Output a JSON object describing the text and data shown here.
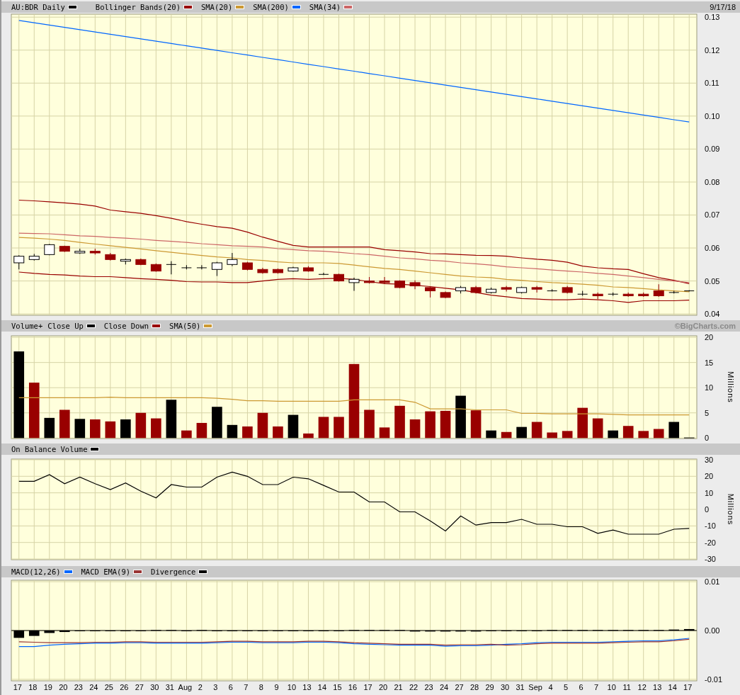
{
  "x_axis": {
    "labels": [
      "17",
      "18",
      "19",
      "20",
      "23",
      "24",
      "25",
      "26",
      "27",
      "30",
      "31",
      "Aug",
      "2",
      "3",
      "6",
      "7",
      "8",
      "9",
      "10",
      "13",
      "14",
      "15",
      "16",
      "17",
      "20",
      "21",
      "22",
      "23",
      "24",
      "27",
      "28",
      "29",
      "30",
      "31",
      "Sep",
      "4",
      "5",
      "6",
      "7",
      "10",
      "11",
      "12",
      "13",
      "14",
      "17"
    ]
  },
  "panels": [
    {
      "kind": "price",
      "right_text": "9/17/18",
      "chart_data": {
        "type": "candlestick",
        "title": "AU:BDR Daily",
        "grid": true,
        "ylim": [
          0.0396,
          0.1309
        ],
        "yticks": [
          {
            "value": 0.04,
            "label": "0.04"
          },
          {
            "value": 0.05,
            "label": "0.05"
          },
          {
            "value": 0.06,
            "label": "0.06"
          },
          {
            "value": 0.07,
            "label": "0.07"
          },
          {
            "value": 0.08,
            "label": "0.08"
          },
          {
            "value": 0.09,
            "label": "0.09"
          },
          {
            "value": 0.1,
            "label": "0.10"
          },
          {
            "value": 0.11,
            "label": "0.11"
          },
          {
            "value": 0.12,
            "label": "0.12"
          },
          {
            "value": 0.13,
            "label": "0.13"
          }
        ],
        "ohlc": [
          [
            0.0555,
            0.0578,
            0.0535,
            0.0575
          ],
          [
            0.0565,
            0.0582,
            0.0562,
            0.0575
          ],
          [
            0.058,
            0.0612,
            0.0578,
            0.061
          ],
          [
            0.0605,
            0.0607,
            0.0588,
            0.059
          ],
          [
            0.0585,
            0.0598,
            0.0582,
            0.059
          ],
          [
            0.059,
            0.0598,
            0.058,
            0.0585
          ],
          [
            0.058,
            0.0585,
            0.0562,
            0.0565
          ],
          [
            0.056,
            0.0568,
            0.055,
            0.0565
          ],
          [
            0.0565,
            0.0568,
            0.0548,
            0.055
          ],
          [
            0.055,
            0.0553,
            0.0528,
            0.053
          ],
          [
            0.055,
            0.056,
            0.052,
            0.055
          ],
          [
            0.054,
            0.0548,
            0.0535,
            0.054
          ],
          [
            0.054,
            0.0548,
            0.0535,
            0.054
          ],
          [
            0.0535,
            0.0558,
            0.0515,
            0.0555
          ],
          [
            0.055,
            0.0585,
            0.0545,
            0.0565
          ],
          [
            0.0555,
            0.0558,
            0.0532,
            0.0535
          ],
          [
            0.0535,
            0.054,
            0.0522,
            0.0525
          ],
          [
            0.0535,
            0.0538,
            0.0522,
            0.0525
          ],
          [
            0.053,
            0.0543,
            0.0528,
            0.054
          ],
          [
            0.054,
            0.0545,
            0.0528,
            0.053
          ],
          [
            0.052,
            0.0525,
            0.0518,
            0.052
          ],
          [
            0.052,
            0.0522,
            0.0498,
            0.05
          ],
          [
            0.0495,
            0.051,
            0.047,
            0.0505
          ],
          [
            0.05,
            0.0512,
            0.0492,
            0.0495
          ],
          [
            0.05,
            0.0512,
            0.0492,
            0.0495
          ],
          [
            0.05,
            0.0502,
            0.0478,
            0.048
          ],
          [
            0.0495,
            0.0502,
            0.0475,
            0.0485
          ],
          [
            0.048,
            0.0483,
            0.045,
            0.047
          ],
          [
            0.0465,
            0.0468,
            0.0448,
            0.045
          ],
          [
            0.047,
            0.0485,
            0.0462,
            0.048
          ],
          [
            0.048,
            0.0485,
            0.0462,
            0.0465
          ],
          [
            0.0465,
            0.048,
            0.0462,
            0.0475
          ],
          [
            0.048,
            0.0485,
            0.0468,
            0.0475
          ],
          [
            0.0465,
            0.0483,
            0.0462,
            0.048
          ],
          [
            0.048,
            0.0485,
            0.0465,
            0.0475
          ],
          [
            0.047,
            0.0475,
            0.0468,
            0.047
          ],
          [
            0.048,
            0.0485,
            0.0462,
            0.0465
          ],
          [
            0.046,
            0.047,
            0.0455,
            0.046
          ],
          [
            0.046,
            0.0465,
            0.0445,
            0.0455
          ],
          [
            0.046,
            0.0465,
            0.0455,
            0.046
          ],
          [
            0.046,
            0.0465,
            0.0452,
            0.0455
          ],
          [
            0.046,
            0.0465,
            0.0452,
            0.0455
          ],
          [
            0.047,
            0.049,
            0.0452,
            0.0455
          ],
          [
            0.0465,
            0.047,
            0.0462,
            0.0465
          ],
          [
            0.047,
            0.0472,
            0.0468,
            0.047
          ]
        ],
        "series": [
          {
            "name": "Bollinger Bands(20)",
            "type": "line",
            "color": "#990000",
            "values": [
              0.0745,
              0.0743,
              0.074,
              0.0737,
              0.0733,
              0.0727,
              0.0715,
              0.071,
              0.0705,
              0.0698,
              0.069,
              0.068,
              0.0672,
              0.0665,
              0.066,
              0.0648,
              0.0633,
              0.062,
              0.0608,
              0.0603,
              0.0603,
              0.0603,
              0.0603,
              0.0603,
              0.0595,
              0.0592,
              0.0588,
              0.0583,
              0.0582,
              0.058,
              0.0578,
              0.0577,
              0.0575,
              0.057,
              0.0566,
              0.0563,
              0.0557,
              0.0545,
              0.054,
              0.0537,
              0.0535,
              0.0522,
              0.051,
              0.0502,
              0.0492
            ]
          },
          {
            "type": "line",
            "color": "#990000",
            "values": [
              0.0527,
              0.0523,
              0.052,
              0.0518,
              0.0515,
              0.0513,
              0.0513,
              0.051,
              0.0507,
              0.0505,
              0.0502,
              0.0498,
              0.0497,
              0.0497,
              0.0495,
              0.0495,
              0.05,
              0.0505,
              0.0507,
              0.0505,
              0.0507,
              0.0508,
              0.0505,
              0.0498,
              0.0492,
              0.049,
              0.0487,
              0.0483,
              0.0478,
              0.0473,
              0.0465,
              0.0457,
              0.0452,
              0.0447,
              0.0445,
              0.0443,
              0.0443,
              0.0445,
              0.0443,
              0.044,
              0.0435,
              0.044,
              0.044,
              0.044,
              0.0442
            ]
          },
          {
            "name": "SMA(20)",
            "type": "line",
            "color": "#cc9933",
            "values": [
              0.0632,
              0.063,
              0.0627,
              0.0623,
              0.0617,
              0.0612,
              0.0607,
              0.0602,
              0.0597,
              0.0592,
              0.0587,
              0.0582,
              0.0577,
              0.0573,
              0.057,
              0.0565,
              0.0562,
              0.0558,
              0.0555,
              0.0555,
              0.0555,
              0.0553,
              0.0548,
              0.0543,
              0.0538,
              0.0535,
              0.053,
              0.0525,
              0.052,
              0.0515,
              0.0512,
              0.051,
              0.0505,
              0.0502,
              0.0498,
              0.0495,
              0.0493,
              0.049,
              0.0487,
              0.0482,
              0.048,
              0.0477,
              0.0473,
              0.047,
              0.0467
            ]
          },
          {
            "name": "SMA(200)",
            "type": "line",
            "color": "#0066ff",
            "values": [
              0.129,
              0.1283,
              0.1276,
              0.1269,
              0.1262,
              0.1255,
              0.1248,
              0.1241,
              0.1234,
              0.1227,
              0.122,
              0.1213,
              0.1206,
              0.1199,
              0.1192,
              0.1185,
              0.1178,
              0.1171,
              0.1164,
              0.1157,
              0.115,
              0.1143,
              0.1136,
              0.1129,
              0.1122,
              0.1115,
              0.1108,
              0.1101,
              0.1094,
              0.1087,
              0.108,
              0.1073,
              0.1066,
              0.1059,
              0.1052,
              0.1045,
              0.1038,
              0.1031,
              0.1024,
              0.1017,
              0.101,
              0.1003,
              0.0996,
              0.0989,
              0.0982
            ]
          },
          {
            "name": "SMA(34)",
            "type": "line",
            "color": "#cc6666",
            "values": [
              0.0645,
              0.0644,
              0.0643,
              0.064,
              0.0637,
              0.0635,
              0.0632,
              0.063,
              0.0627,
              0.0623,
              0.062,
              0.0617,
              0.0613,
              0.061,
              0.0607,
              0.0605,
              0.0603,
              0.0598,
              0.0595,
              0.0592,
              0.059,
              0.0587,
              0.0583,
              0.058,
              0.0575,
              0.057,
              0.0567,
              0.0563,
              0.056,
              0.0555,
              0.0552,
              0.0548,
              0.0543,
              0.054,
              0.0537,
              0.0533,
              0.053,
              0.0527,
              0.0523,
              0.052,
              0.0515,
              0.051,
              0.0505,
              0.05,
              0.0495
            ]
          }
        ]
      }
    },
    {
      "kind": "volume",
      "right_text": "©BigCharts.com",
      "chart_data": {
        "type": "bar",
        "title": "Volume+",
        "grid": true,
        "ylabel": "Millions",
        "ylim": [
          -0.1,
          20.3
        ],
        "yticks": [
          {
            "value": 0,
            "label": "0"
          },
          {
            "value": 5,
            "label": "5"
          },
          {
            "value": 10,
            "label": "10"
          },
          {
            "value": 15,
            "label": "15"
          },
          {
            "value": 20,
            "label": "20"
          }
        ],
        "series": [
          {
            "name": "Close Up",
            "color": "#000000",
            "values": [
              17.2,
              null,
              4,
              null,
              3.8,
              null,
              null,
              3.7,
              null,
              null,
              7.6,
              null,
              null,
              6.2,
              2.6,
              null,
              null,
              null,
              4.6,
              null,
              null,
              null,
              null,
              null,
              null,
              null,
              null,
              null,
              null,
              8.4,
              null,
              1.5,
              null,
              2.2,
              null,
              null,
              null,
              null,
              null,
              1.5,
              null,
              null,
              null,
              3.2,
              0.1
            ]
          },
          {
            "name": "Close Down",
            "color": "#990000",
            "values": [
              null,
              11,
              null,
              5.6,
              null,
              3.7,
              3.3,
              null,
              5,
              3.9,
              null,
              1.5,
              3,
              null,
              null,
              2.3,
              5,
              2.3,
              null,
              0.9,
              4.2,
              4.2,
              14.7,
              5.6,
              2.1,
              6.4,
              3.7,
              5.3,
              5.4,
              null,
              5.5,
              null,
              1.2,
              null,
              3.2,
              1.1,
              1.4,
              6,
              3.9,
              null,
              2.4,
              1.4,
              1.8,
              null,
              null
            ]
          },
          {
            "name": "SMA(50)",
            "type": "line",
            "color": "#cc9933",
            "values": [
              8,
              8,
              8,
              8,
              8,
              8,
              8.1,
              8,
              8,
              8,
              8,
              8,
              8,
              7.9,
              7.7,
              7.4,
              7.4,
              7.3,
              7.3,
              7.3,
              7.3,
              7.3,
              7.6,
              7.6,
              7.6,
              7.6,
              7.1,
              5.8,
              5.8,
              5.8,
              5.6,
              5.6,
              5.6,
              4.9,
              4.9,
              4.8,
              4.8,
              4.8,
              4.8,
              4.7,
              4.6,
              4.6,
              4.6,
              4.6,
              4.6
            ]
          }
        ]
      }
    },
    {
      "kind": "obv",
      "chart_data": {
        "type": "line",
        "grid": true,
        "ylabel": "Millions",
        "ylim": [
          -30.4,
          30.4
        ],
        "yticks": [
          {
            "value": -30,
            "label": "-30"
          },
          {
            "value": -20,
            "label": "-20"
          },
          {
            "value": -10,
            "label": "-10"
          },
          {
            "value": 0,
            "label": "0"
          },
          {
            "value": 10,
            "label": "10"
          },
          {
            "value": 20,
            "label": "20"
          },
          {
            "value": 30,
            "label": "30"
          }
        ],
        "series": [
          {
            "name": "On Balance Volume",
            "color": "#000000",
            "values": [
              17,
              17,
              21,
              15.5,
              19.5,
              15.5,
              12,
              16,
              11,
              7,
              15,
              13.5,
              13.5,
              19.5,
              22.5,
              20,
              15,
              15,
              19.5,
              18.5,
              14.5,
              10.5,
              10.5,
              4.5,
              4.5,
              -1.5,
              -1.5,
              -7,
              -13,
              -4,
              -9.5,
              -8,
              -8,
              -6,
              -9,
              -9,
              -10.5,
              -10.5,
              -14.5,
              -12.5,
              -15,
              -15,
              -15,
              -12,
              -11.5
            ]
          }
        ]
      }
    },
    {
      "kind": "macd",
      "chart_data": {
        "type": "line",
        "grid": true,
        "ylim": [
          -0.0103,
          0.0103
        ],
        "yticks": [
          {
            "value": -0.01,
            "label": "-0.01"
          },
          {
            "value": 0,
            "label": "0.00"
          },
          {
            "value": 0.01,
            "label": "0.01"
          }
        ],
        "series": [
          {
            "name": "MACD(12,26)",
            "color": "#0066ff",
            "values": [
              -0.0033,
              -0.0033,
              -0.003,
              -0.0028,
              -0.0027,
              -0.0026,
              -0.0026,
              -0.0025,
              -0.0025,
              -0.0026,
              -0.0026,
              -0.0026,
              -0.0026,
              -0.0025,
              -0.0024,
              -0.0024,
              -0.0025,
              -0.0025,
              -0.0025,
              -0.0024,
              -0.0024,
              -0.0025,
              -0.0027,
              -0.0028,
              -0.0029,
              -0.003,
              -0.003,
              -0.003,
              -0.0032,
              -0.0031,
              -0.0031,
              -0.003,
              -0.0028,
              -0.0027,
              -0.0025,
              -0.0024,
              -0.0024,
              -0.0024,
              -0.0024,
              -0.0023,
              -0.0022,
              -0.0021,
              -0.0021,
              -0.0019,
              -0.0016
            ]
          },
          {
            "name": "MACD EMA(9)",
            "color": "#993333",
            "values": [
              -0.0023,
              -0.0024,
              -0.0025,
              -0.0025,
              -0.0025,
              -0.0024,
              -0.0024,
              -0.0023,
              -0.0023,
              -0.0024,
              -0.0024,
              -0.0024,
              -0.0024,
              -0.0023,
              -0.0022,
              -0.0022,
              -0.0023,
              -0.0023,
              -0.0023,
              -0.0022,
              -0.0022,
              -0.0023,
              -0.0025,
              -0.0026,
              -0.0027,
              -0.0028,
              -0.0028,
              -0.0028,
              -0.003,
              -0.0029,
              -0.0029,
              -0.0028,
              -0.003,
              -0.0029,
              -0.0027,
              -0.0026,
              -0.0026,
              -0.0026,
              -0.0026,
              -0.0025,
              -0.0024,
              -0.0023,
              -0.0023,
              -0.0021,
              -0.0018
            ]
          },
          {
            "name": "Divergence",
            "type": "bar",
            "color": "#000000",
            "values": [
              -0.0015,
              -0.0011,
              -0.0005,
              -0.0003,
              0,
              0,
              0,
              0,
              0,
              0.0001,
              0.0001,
              -0.0001,
              0.0001,
              0,
              0,
              0,
              0,
              0,
              0,
              0,
              0,
              0,
              0.0001,
              0.0001,
              0.0001,
              0.0001,
              -0.0002,
              -0.0002,
              -0.0002,
              -0.0002,
              -0.0002,
              -0.0001,
              0,
              0,
              0,
              0.0001,
              0.0001,
              0.0001,
              0.0001,
              0.0001,
              0.0001,
              0.0001,
              0.0001,
              0.0002,
              0.0003
            ]
          }
        ]
      }
    }
  ]
}
